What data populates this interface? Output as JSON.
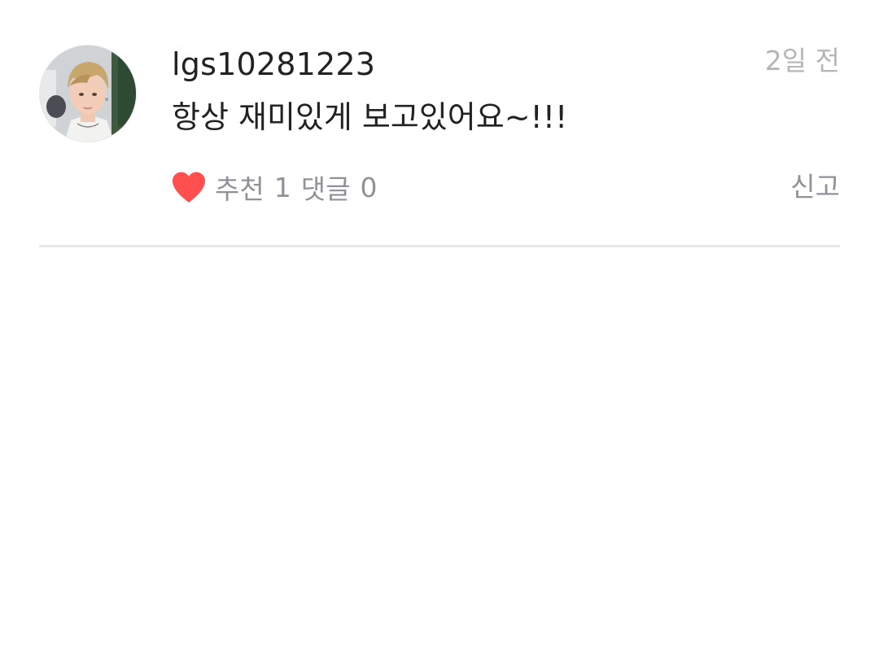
{
  "comment": {
    "username": "lgs10281223",
    "time": "2일 전",
    "message": "항상 재미있게 보고있어요~!!!",
    "recommend_label": "추천",
    "recommend_count": "1",
    "reply_label": "댓글",
    "reply_count": "0",
    "report_label": "신고"
  },
  "colors": {
    "heart": "#ff4f4f",
    "text_primary": "#222222",
    "text_secondary": "#8f9399",
    "time": "#b3b6ba",
    "divider": "#e6e7e8"
  },
  "icons": {
    "like": "heart-icon",
    "avatar": "profile-photo"
  }
}
